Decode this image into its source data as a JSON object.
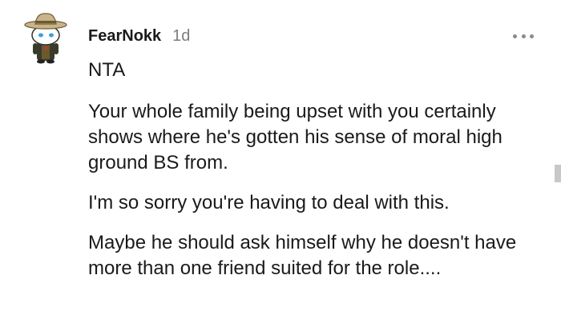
{
  "comment": {
    "username": "FearNokk",
    "age": "1d",
    "avatar": "snoo-cowboy-avatar",
    "menu_icon": "more-options-icon",
    "paragraphs": [
      "NTA",
      "Your whole family being upset with you certainly shows where he's gotten his sense of moral high ground BS from.",
      "I'm so sorry you're having to deal with this.",
      "Maybe he should ask himself why he doesn't have more than one friend suited for the role...."
    ]
  },
  "colors": {
    "text": "#1a1a1b",
    "meta": "#7c7c7c",
    "icon": "#878a8c"
  }
}
